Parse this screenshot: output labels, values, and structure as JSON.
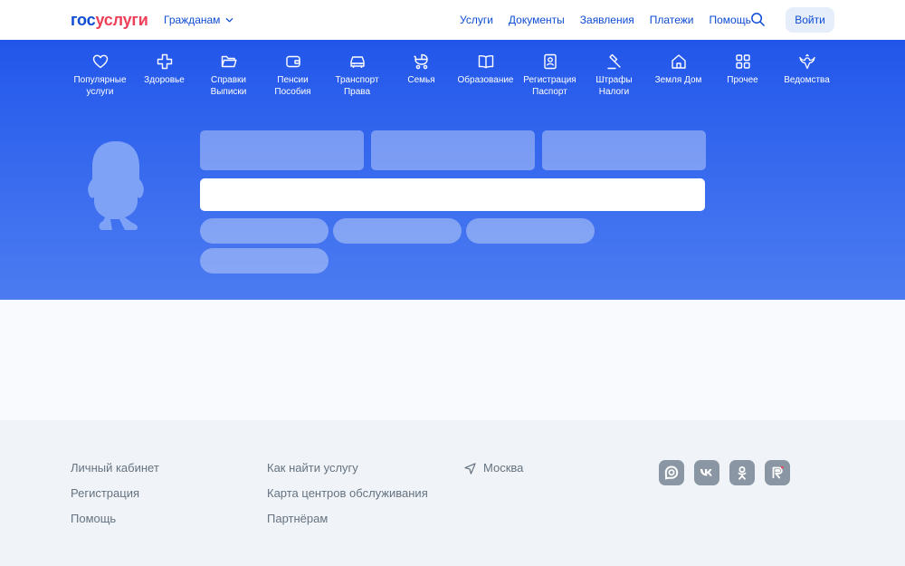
{
  "header": {
    "logo_part1": "гос",
    "logo_part2": "услуги",
    "audience_label": "Гражданам",
    "nav": [
      "Услуги",
      "Документы",
      "Заявления",
      "Платежи",
      "Помощь"
    ],
    "login_label": "Войти"
  },
  "categories": [
    {
      "icon": "heart-icon",
      "line1": "Популярные",
      "line2": "услуги"
    },
    {
      "icon": "medical-cross-icon",
      "line1": "Здоровье",
      "line2": ""
    },
    {
      "icon": "folder-icon",
      "line1": "Справки",
      "line2": "Выписки"
    },
    {
      "icon": "wallet-icon",
      "line1": "Пенсии",
      "line2": "Пособия"
    },
    {
      "icon": "car-icon",
      "line1": "Транспорт",
      "line2": "Права"
    },
    {
      "icon": "stroller-icon",
      "line1": "Семья",
      "line2": ""
    },
    {
      "icon": "book-icon",
      "line1": "Образование",
      "line2": ""
    },
    {
      "icon": "passport-icon",
      "line1": "Регистрация",
      "line2": "Паспорт"
    },
    {
      "icon": "gavel-icon",
      "line1": "Штрафы",
      "line2": "Налоги"
    },
    {
      "icon": "house-icon",
      "line1": "Земля Дом",
      "line2": ""
    },
    {
      "icon": "grid-icon",
      "line1": "Прочее",
      "line2": ""
    },
    {
      "icon": "eagle-emblem-icon",
      "line1": "Ведомства",
      "line2": ""
    }
  ],
  "search": {
    "value": "",
    "placeholder": ""
  },
  "footer": {
    "col1": [
      "Личный кабинет",
      "Регистрация",
      "Помощь"
    ],
    "col2": [
      "Как найти услугу",
      "Карта центров обслуживания",
      "Партнёрам"
    ],
    "city": "Москва",
    "socials": [
      "max-messenger-icon",
      "vk-icon",
      "odnoklassniki-icon",
      "rutube-icon"
    ]
  },
  "colors": {
    "brand_blue": "#0d4cd3",
    "brand_red": "#ee3f58",
    "hero_blue": "#2256ea",
    "footer_bg": "#f0f4f9",
    "muted_text": "#66727f"
  }
}
